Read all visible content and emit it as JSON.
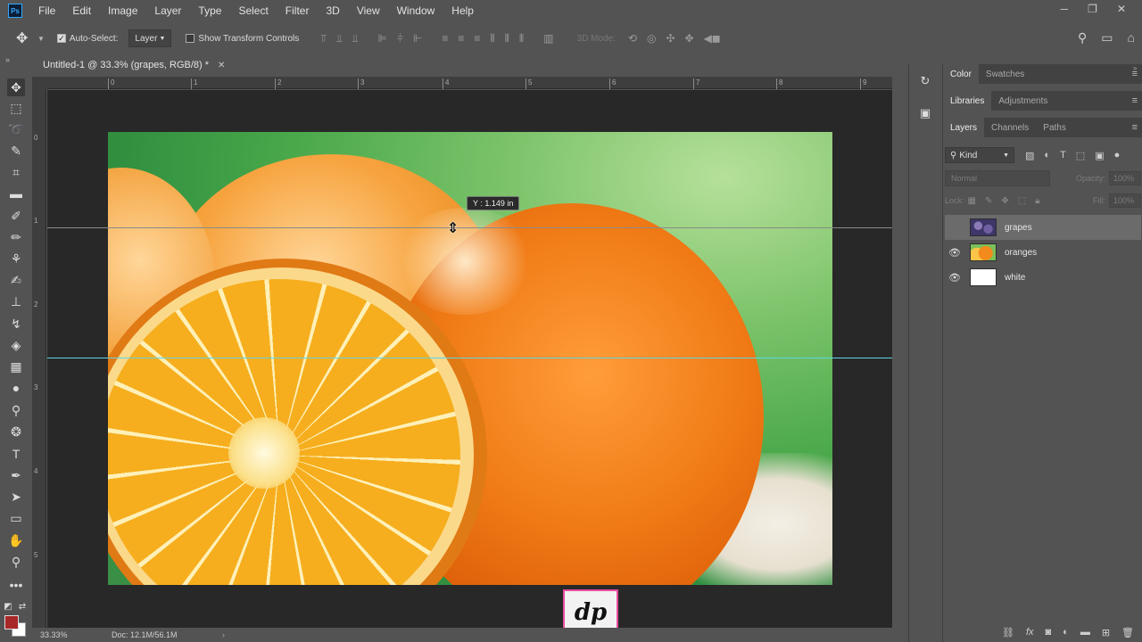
{
  "app": {
    "logo": "Ps"
  },
  "menu": [
    "File",
    "Edit",
    "Image",
    "Layer",
    "Type",
    "Select",
    "Filter",
    "3D",
    "View",
    "Window",
    "Help"
  ],
  "window_controls": {
    "minimize": "─",
    "restore": "❐",
    "close": "✕"
  },
  "options": {
    "auto_select_label": "Auto-Select:",
    "auto_select_checked": true,
    "auto_select_value": "Layer",
    "show_transform_label": "Show Transform Controls",
    "show_transform_checked": false,
    "mode_3d_label": "3D Mode:"
  },
  "document": {
    "tab_title": "Untitled-1 @ 33.3% (grapes, RGB/8) *",
    "close_glyph": "✕",
    "ruler_h": [
      "0",
      "1",
      "2",
      "3",
      "4",
      "5",
      "6",
      "7",
      "8",
      "9"
    ],
    "ruler_v": [
      "0",
      "1",
      "2",
      "3",
      "4",
      "5"
    ],
    "guide_tooltip": "Y :  1.149 in",
    "watermark_text": "dp"
  },
  "statusbar": {
    "zoom": "33.33%",
    "doc": "Doc: 12.1M/56.1M",
    "arrow": "›"
  },
  "swatches": {
    "foreground": "#a82727",
    "background": "#ffffff"
  },
  "panels": {
    "group1_tabs": [
      "Color",
      "Swatches"
    ],
    "group2_tabs": [
      "Libraries",
      "Adjustments"
    ],
    "group3_tabs": [
      "Layers",
      "Channels",
      "Paths"
    ],
    "layers": {
      "kind_label": "Kind",
      "blend_mode": "Normal",
      "opacity_label": "Opacity:",
      "opacity_value": "100%",
      "lock_label": "Lock:",
      "fill_label": "Fill:",
      "fill_value": "100%",
      "items": [
        {
          "name": "grapes",
          "visible": false,
          "selected": true
        },
        {
          "name": "oranges",
          "visible": true,
          "selected": false
        },
        {
          "name": "white",
          "visible": true,
          "selected": false
        }
      ]
    }
  }
}
